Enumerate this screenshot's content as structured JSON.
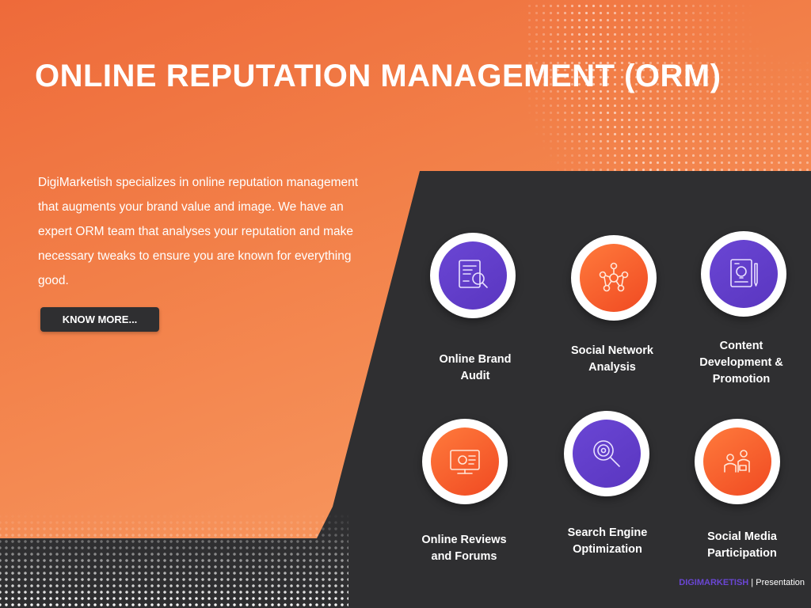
{
  "slide": {
    "title": "ONLINE REPUTATION MANAGEMENT (ORM)",
    "description": "DigiMarketish specializes in online reputation management that augments your brand value and image. We have an expert ORM team that analyses your reputation and make necessary tweaks to ensure you are known for everything good.",
    "button_label": "KNOW MORE..."
  },
  "services": [
    {
      "label_line1": "Online Brand",
      "label_line2": "Audit",
      "icon": "audit-report-icon",
      "color": "purple"
    },
    {
      "label_line1": "Social Network",
      "label_line2": "Analysis",
      "icon": "network-nodes-icon",
      "color": "orange"
    },
    {
      "label_line1": "Content",
      "label_line2": "Development &",
      "label_line3": "Promotion",
      "icon": "content-idea-icon",
      "color": "purple"
    },
    {
      "label_line1": "Online Reviews",
      "label_line2": "and Forums",
      "icon": "review-screen-icon",
      "color": "orange"
    },
    {
      "label_line1": "Search Engine",
      "label_line2": "Optimization",
      "icon": "search-magnifier-icon",
      "color": "purple"
    },
    {
      "label_line1": "Social Media",
      "label_line2": "Participation",
      "icon": "social-people-icon",
      "color": "orange"
    }
  ],
  "footer": {
    "brand": "DIGIMARKETISH",
    "separator": " | ",
    "suffix": "Presentation"
  },
  "colors": {
    "orange": "#f27f48",
    "dark": "#2f2f31",
    "purple": "#6a46d4",
    "accent_orange": "#f04a22"
  }
}
